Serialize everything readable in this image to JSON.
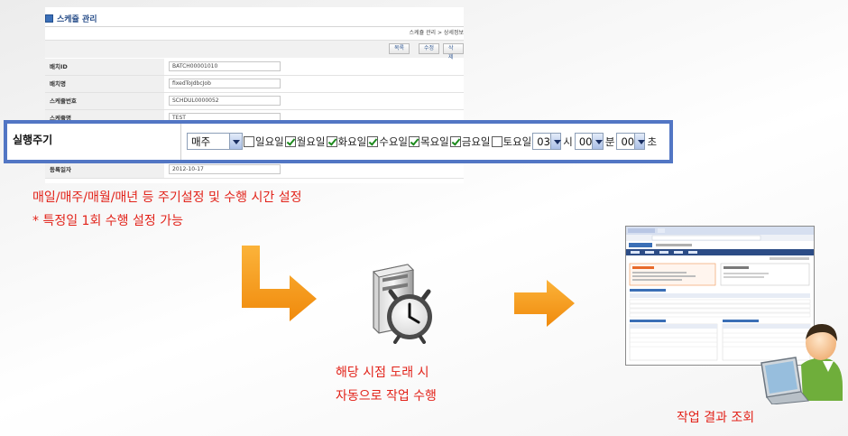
{
  "schedule_form": {
    "title": "스케쥴 관리",
    "breadcrumb_parent": "스케쥴 관리 >",
    "breadcrumb_current": "상세정보",
    "buttons": {
      "list": "목록",
      "edit": "수정",
      "delete": "삭제"
    },
    "fields": [
      {
        "label": "배치ID",
        "value": "BATCH00001010"
      },
      {
        "label": "배치명",
        "value": "fixedToJdbcJob"
      },
      {
        "label": "스케쥴번호",
        "value": "SCHDUL0000052"
      },
      {
        "label": "스케쥴명",
        "value": "TEST"
      },
      {
        "label": "등록일자",
        "value": "2012-10-17"
      }
    ]
  },
  "execution_cycle": {
    "label": "실행주기",
    "cycle_value": "매주",
    "days": [
      {
        "label": "일요일",
        "checked": false
      },
      {
        "label": "월요일",
        "checked": true
      },
      {
        "label": "화요일",
        "checked": true
      },
      {
        "label": "수요일",
        "checked": true
      },
      {
        "label": "목요일",
        "checked": true
      },
      {
        "label": "금요일",
        "checked": true
      },
      {
        "label": "토요일",
        "checked": false
      }
    ],
    "hour_value": "03",
    "hour_unit": "시",
    "minute_value": "00",
    "minute_unit": "분",
    "second_value": "00",
    "second_unit": "초"
  },
  "captions": {
    "desc_line1": "매일/매주/매월/매년 등 주기설정 및 수행 시간 설정",
    "desc_line2": "* 특정일 1회 수행 설정 가능",
    "auto_line1": "해당 시점 도래 시",
    "auto_line2": "자동으로 작업 수행",
    "result": "작업 결과 조회"
  },
  "colors": {
    "accent_text": "#e2231a",
    "highlight_border": "#5276c4",
    "arrow": "#f59a12",
    "link_blue": "#2a4f8a"
  },
  "icons": [
    "bent-arrow-icon",
    "scheduler-server-clock-icon",
    "right-arrow-icon",
    "result-screen-thumbnail",
    "user-at-computer-icon"
  ]
}
